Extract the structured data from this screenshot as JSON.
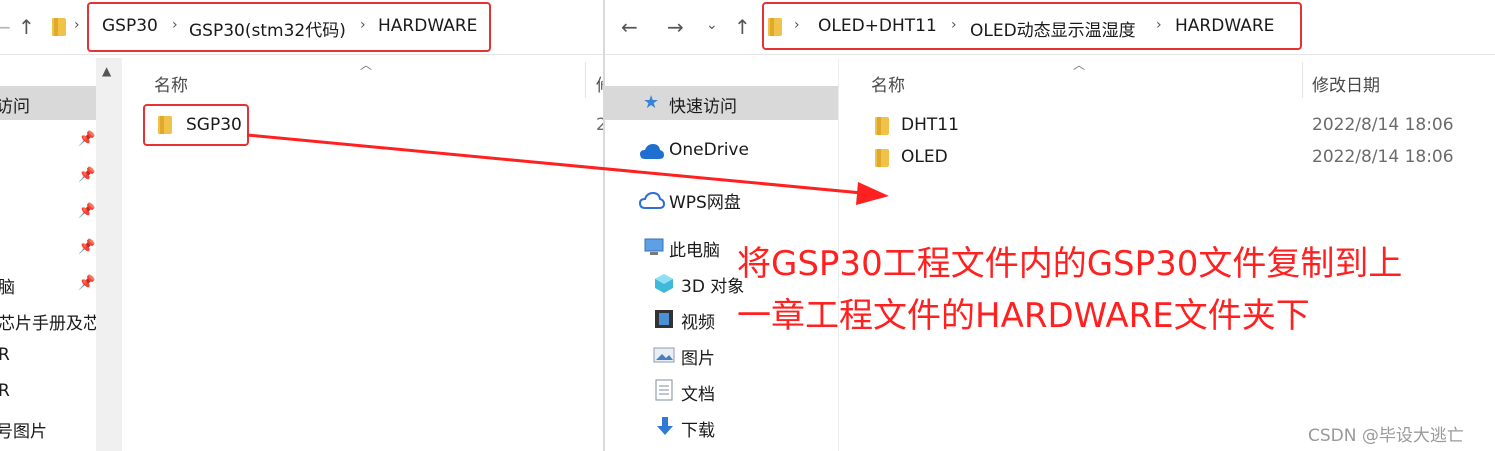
{
  "left_window": {
    "address": [
      "GSP30",
      "GSP30(stm32代码)",
      "HARDWARE"
    ],
    "sidebar_items": [
      "访问",
      "",
      "",
      "",
      "",
      "脑",
      "芯片手册及芯",
      "R",
      "R",
      "号图片"
    ],
    "column_name": "名称",
    "column_date_partial": "修",
    "files": [
      {
        "name": "SGP30",
        "date_partial": "2"
      }
    ]
  },
  "right_window": {
    "address": [
      "OLED+DHT11",
      "OLED动态显示温湿度",
      "HARDWARE"
    ],
    "sidebar": {
      "quick_access": "快速访问",
      "onedrive": "OneDrive",
      "wps": "WPS网盘",
      "this_pc": "此电脑",
      "objects3d": "3D 对象",
      "videos": "视频",
      "pictures": "图片",
      "documents": "文档",
      "downloads": "下载"
    },
    "column_name": "名称",
    "column_date": "修改日期",
    "files": [
      {
        "name": "DHT11",
        "date": "2022/8/14 18:06"
      },
      {
        "name": "OLED",
        "date": "2022/8/14 18:06"
      }
    ]
  },
  "annotation": {
    "line1": "将GSP30工程文件内的GSP30文件复制到上",
    "line2": "一章工程文件的HARDWARE文件夹下",
    "color": "#ff2020"
  },
  "watermark": "CSDN @毕设大逃亡",
  "colors": {
    "highlight_box": "#e53333",
    "selection": "#d9d9d9",
    "folder": "#f0c24a"
  }
}
